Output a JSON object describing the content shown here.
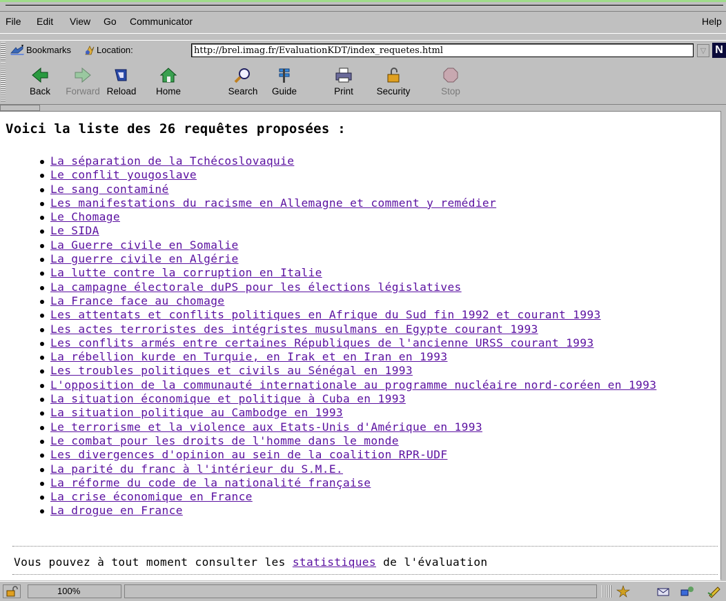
{
  "menu": {
    "items": [
      "File",
      "Edit",
      "View",
      "Go",
      "Communicator"
    ],
    "help": "Help"
  },
  "location_bar": {
    "bookmarks_label": "Bookmarks",
    "location_label": "Location:",
    "url": "http://brel.imag.fr/EvaluationKDT/index_requetes.html",
    "logo": "N"
  },
  "nav_buttons": [
    {
      "label": "Back",
      "icon": "back-arrow-icon",
      "enabled": true
    },
    {
      "label": "Forward",
      "icon": "forward-arrow-icon",
      "enabled": false
    },
    {
      "label": "Reload",
      "icon": "reload-icon",
      "enabled": true
    },
    {
      "label": "Home",
      "icon": "home-icon",
      "enabled": true
    },
    {
      "label": "Search",
      "icon": "search-icon",
      "enabled": true
    },
    {
      "label": "Guide",
      "icon": "guide-icon",
      "enabled": true
    },
    {
      "label": "Print",
      "icon": "print-icon",
      "enabled": true
    },
    {
      "label": "Security",
      "icon": "security-lock-icon",
      "enabled": true
    },
    {
      "label": "Stop",
      "icon": "stop-icon",
      "enabled": false
    }
  ],
  "page": {
    "heading": "Voici la liste des 26 requêtes proposées :",
    "queries": [
      "La séparation de la Tchécoslovaquie",
      "Le conflit yougoslave",
      "Le sang contaminé",
      "Les manifestations du racisme en Allemagne et comment y remédier",
      "Le Chomage",
      "Le SIDA",
      "La Guerre civile en Somalie",
      "La guerre civile en Algérie",
      "La lutte contre la corruption en Italie",
      "La campagne électorale duPS pour les élections législatives",
      "La France face au chomage",
      "Les attentats et conflits politiques en Afrique du Sud fin 1992 et courant 1993",
      "Les actes terroristes des intégristes musulmans en Egypte courant 1993",
      "Les conflits armés entre certaines Républiques de l'ancienne URSS courant 1993",
      "La rébellion kurde en Turquie, en Irak et en Iran en 1993",
      "Les troubles politiques et civils au Sénégal en 1993",
      "L'opposition de la communauté internationale au programme nucléaire nord-coréen en 1993",
      "La situation économique et politique à Cuba en 1993",
      "La situation politique au Cambodge en 1993",
      "Le terrorisme et la violence aux Etats-Unis d'Amérique en 1993",
      "Le combat pour les droits de l'homme dans le monde",
      "Les divergences d'opinion au sein de la coalition RPR-UDF",
      "La parité du franc à l'intérieur du S.M.E.",
      "La réforme du code de la nationalité française",
      "La crise économique en France",
      "La drogue en France"
    ],
    "footer": {
      "before": "Vous pouvez à tout moment consulter les ",
      "link": "statistiques",
      "after": " de l'évaluation"
    }
  },
  "status": {
    "progress": "100%"
  },
  "colors": {
    "chrome": "#c0c0c0",
    "link_visited": "#5a10a0"
  }
}
